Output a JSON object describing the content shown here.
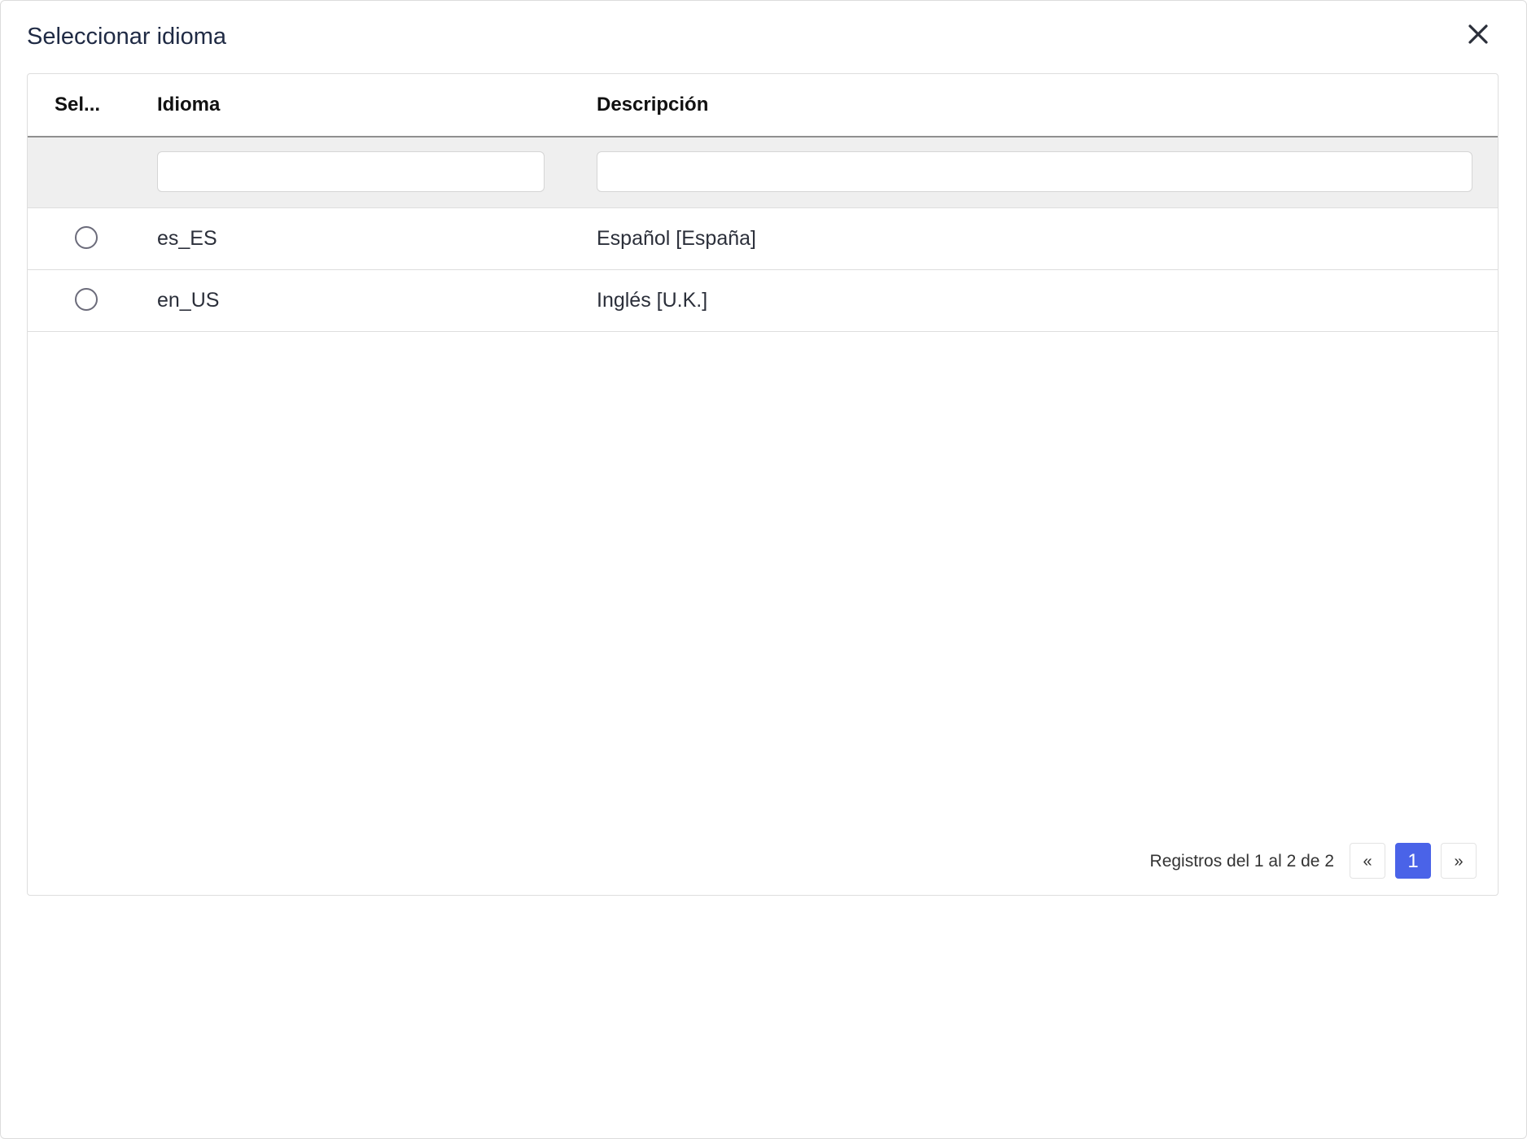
{
  "dialog": {
    "title": "Seleccionar idioma",
    "close_icon": "close-icon"
  },
  "table": {
    "columns": [
      {
        "label": "Sel..."
      },
      {
        "label": "Idioma"
      },
      {
        "label": "Descripción"
      }
    ],
    "filters": {
      "idioma": {
        "value": "",
        "placeholder": ""
      },
      "descripcion": {
        "value": "",
        "placeholder": ""
      }
    },
    "rows": [
      {
        "selected": false,
        "idioma": "es_ES",
        "descripcion": "Español [España]"
      },
      {
        "selected": false,
        "idioma": "en_US",
        "descripcion": "Inglés [U.K.]"
      }
    ]
  },
  "pagination": {
    "info": "Registros del 1 al 2 de 2",
    "prev_label": "«",
    "current_page": "1",
    "next_label": "»"
  },
  "colors": {
    "accent": "#4a63e8",
    "header_border": "#8f8f8f",
    "filter_background": "#efefef"
  }
}
